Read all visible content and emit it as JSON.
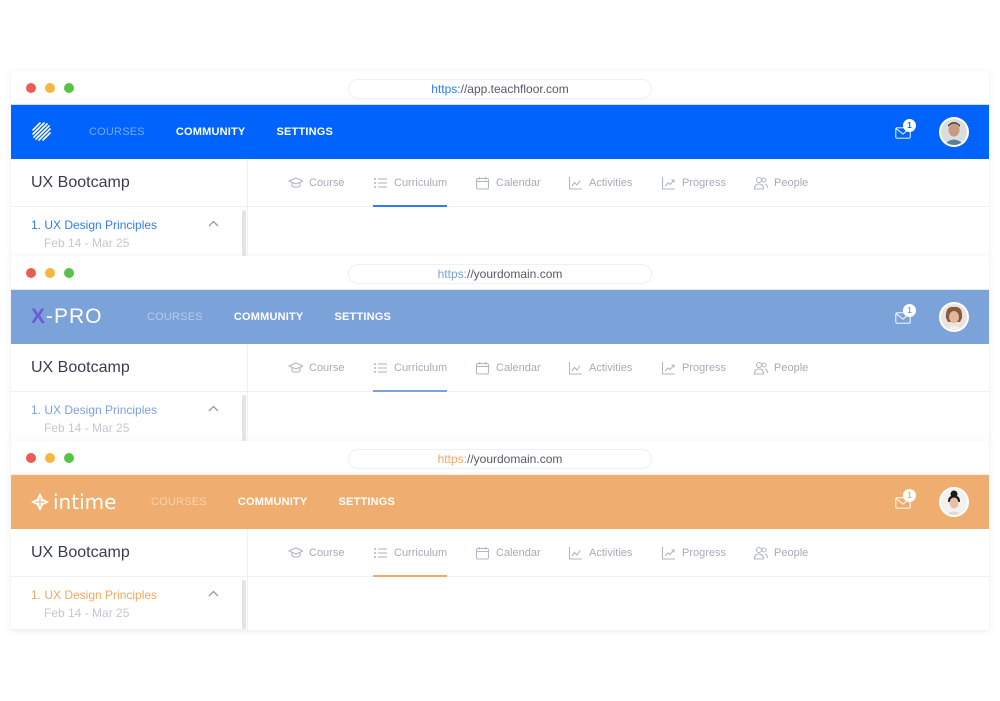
{
  "windows": [
    {
      "theme_color": "#0063fb",
      "accent_color": "#2f7cf6",
      "url_scheme": "https:",
      "url_rest": "//app.teachfloor.com",
      "logo": {
        "type": "stripes",
        "text": ""
      },
      "nav": [
        "COURSES",
        "COMMUNITY",
        "SETTINGS"
      ],
      "active_nav": 0,
      "mail_badge": "1",
      "avatar": "male-user-avatar",
      "course_title": "UX Bootcamp",
      "tabs": [
        "Course",
        "Curriculum",
        "Calendar",
        "Activities",
        "Progress",
        "People"
      ],
      "active_tab": 1,
      "module_title": "1. UX Design Principles",
      "module_date": "Feb 14 - Mar 25"
    },
    {
      "theme_color": "#7ba2d9",
      "accent_color": "#7ba2d9",
      "url_scheme": "https:",
      "url_rest": "//yourdomain.com",
      "logo": {
        "type": "xpro",
        "text": "-PRO",
        "mark": "X"
      },
      "nav": [
        "COURSES",
        "COMMUNITY",
        "SETTINGS"
      ],
      "active_nav": 0,
      "mail_badge": "1",
      "avatar": "female-user-avatar",
      "course_title": "UX Bootcamp",
      "tabs": [
        "Course",
        "Curriculum",
        "Calendar",
        "Activities",
        "Progress",
        "People"
      ],
      "active_tab": 1,
      "module_title": "1. UX Design Principles",
      "module_date": "Feb 14 - Mar 25"
    },
    {
      "theme_color": "#efae6f",
      "accent_color": "#f0a862",
      "url_scheme": "https:",
      "url_rest": "//yourdomain.com",
      "logo": {
        "type": "intime",
        "text": "intime"
      },
      "nav": [
        "COURSES",
        "COMMUNITY",
        "SETTINGS"
      ],
      "active_nav": 0,
      "mail_badge": "1",
      "avatar": "female-user-avatar",
      "course_title": "UX Bootcamp",
      "tabs": [
        "Course",
        "Curriculum",
        "Calendar",
        "Activities",
        "Progress",
        "People"
      ],
      "active_tab": 1,
      "module_title": "1. UX Design Principles",
      "module_date": "Feb 14 - Mar 25"
    }
  ]
}
